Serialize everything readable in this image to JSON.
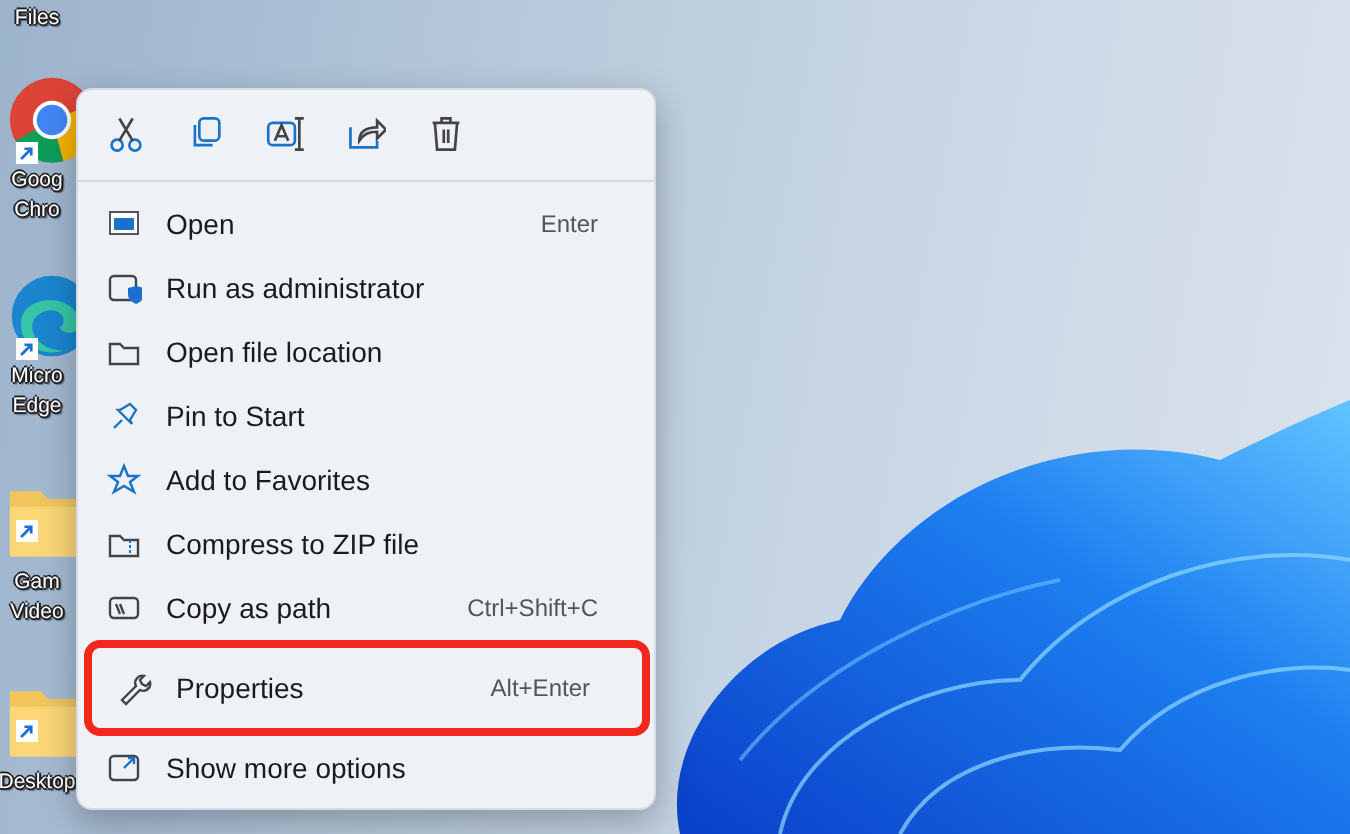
{
  "desktop_icons": [
    {
      "lines": [
        "Files"
      ],
      "kind": "text"
    },
    {
      "lines": [
        "Goog",
        "Chro"
      ],
      "kind": "chrome"
    },
    {
      "lines": [
        "Micro",
        "Edge"
      ],
      "kind": "edge"
    },
    {
      "lines": [
        "Gam",
        "Video"
      ],
      "kind": "folder"
    },
    {
      "lines": [
        "Desktop"
      ],
      "kind": "folder"
    }
  ],
  "context_menu": {
    "items": [
      {
        "label": "Open",
        "shortcut": "Enter",
        "highlighted": false
      },
      {
        "label": "Run as administrator",
        "highlighted": false
      },
      {
        "label": "Open file location",
        "highlighted": false
      },
      {
        "label": "Pin to Start",
        "highlighted": false
      },
      {
        "label": "Add to Favorites",
        "highlighted": false
      },
      {
        "label": "Compress to ZIP file",
        "highlighted": false
      },
      {
        "label": "Copy as path",
        "shortcut": "Ctrl+Shift+C",
        "highlighted": false
      },
      {
        "label": "Properties",
        "shortcut": "Alt+Enter",
        "highlighted": true
      },
      {
        "label": "Show more options",
        "highlighted": false
      }
    ]
  }
}
